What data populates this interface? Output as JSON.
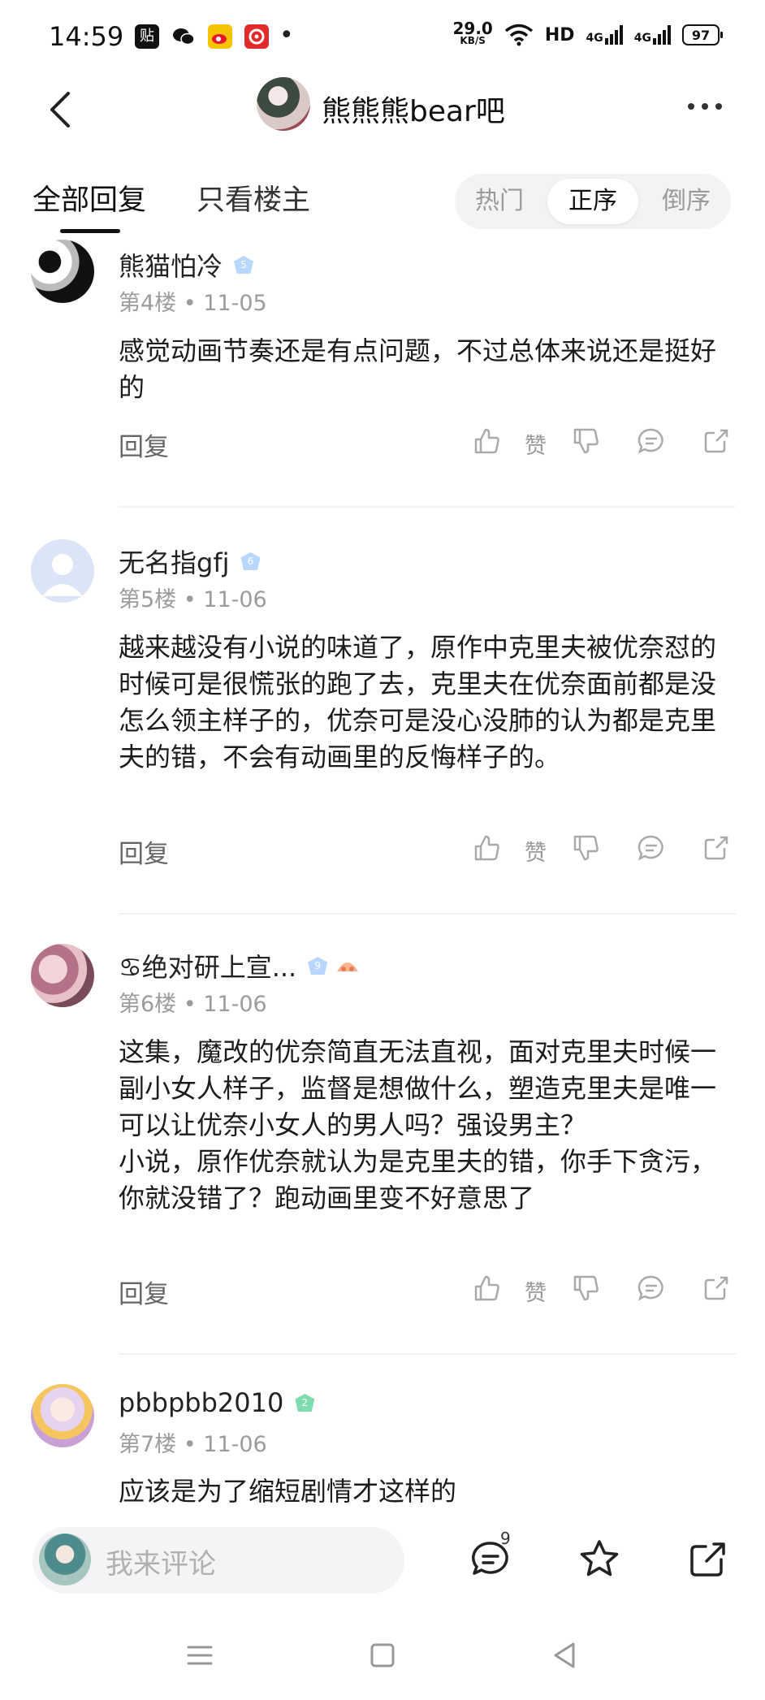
{
  "status_bar": {
    "time": "14:59",
    "apps": [
      "tieba-app-icon",
      "wechat-icon",
      "weibo-icon",
      "netease-music-icon"
    ],
    "dot": "•",
    "speed_value": "29.0",
    "speed_unit": "KB/S",
    "hd": "HD",
    "net1": "4G",
    "net2": "4G",
    "battery": "97"
  },
  "header": {
    "title": "熊熊熊bear吧"
  },
  "tabs": {
    "all": "全部回复",
    "owner_only": "只看楼主",
    "sort_hot": "热门",
    "sort_asc": "正序",
    "sort_desc": "倒序"
  },
  "comments": [
    {
      "user": "熊猫怕冷",
      "level": "5",
      "floor": "第4楼",
      "date": "11-05",
      "text": "感觉动画节奏还是有点问题，不过总体来说还是挺好的",
      "reply": "回复",
      "zan": "赞"
    },
    {
      "user": "无名指gfj",
      "level": "6",
      "floor": "第5楼",
      "date": "11-06",
      "text": "越来越没有小说的味道了，原作中克里夫被优奈怼的时候可是很慌张的跑了去，克里夫在优奈面前都是没怎么领主样子的，优奈可是没心没肺的认为都是克里夫的错，不会有动画里的反悔样子的。",
      "reply": "回复",
      "zan": "赞"
    },
    {
      "user": "♋绝对研上宣...",
      "level": "9",
      "floor": "第6楼",
      "date": "11-06",
      "text": "这集，魔改的优奈简直无法直视，面对克里夫时候一副小女人样子，监督是想做什么，塑造克里夫是唯一可以让优奈小女人的男人吗？强设男主？\n小说，原作优奈就认为是克里夫的错，你手下贪污，你就没错了？跑动画里变不好意思了",
      "reply": "回复",
      "zan": "赞"
    },
    {
      "user": "pbbpbb2010",
      "level": "2",
      "floor": "第7楼",
      "date": "11-06",
      "text": "应该是为了缩短剧情才这样的"
    }
  ],
  "bottom_bar": {
    "placeholder": "我来评论",
    "comment_count": "9"
  }
}
